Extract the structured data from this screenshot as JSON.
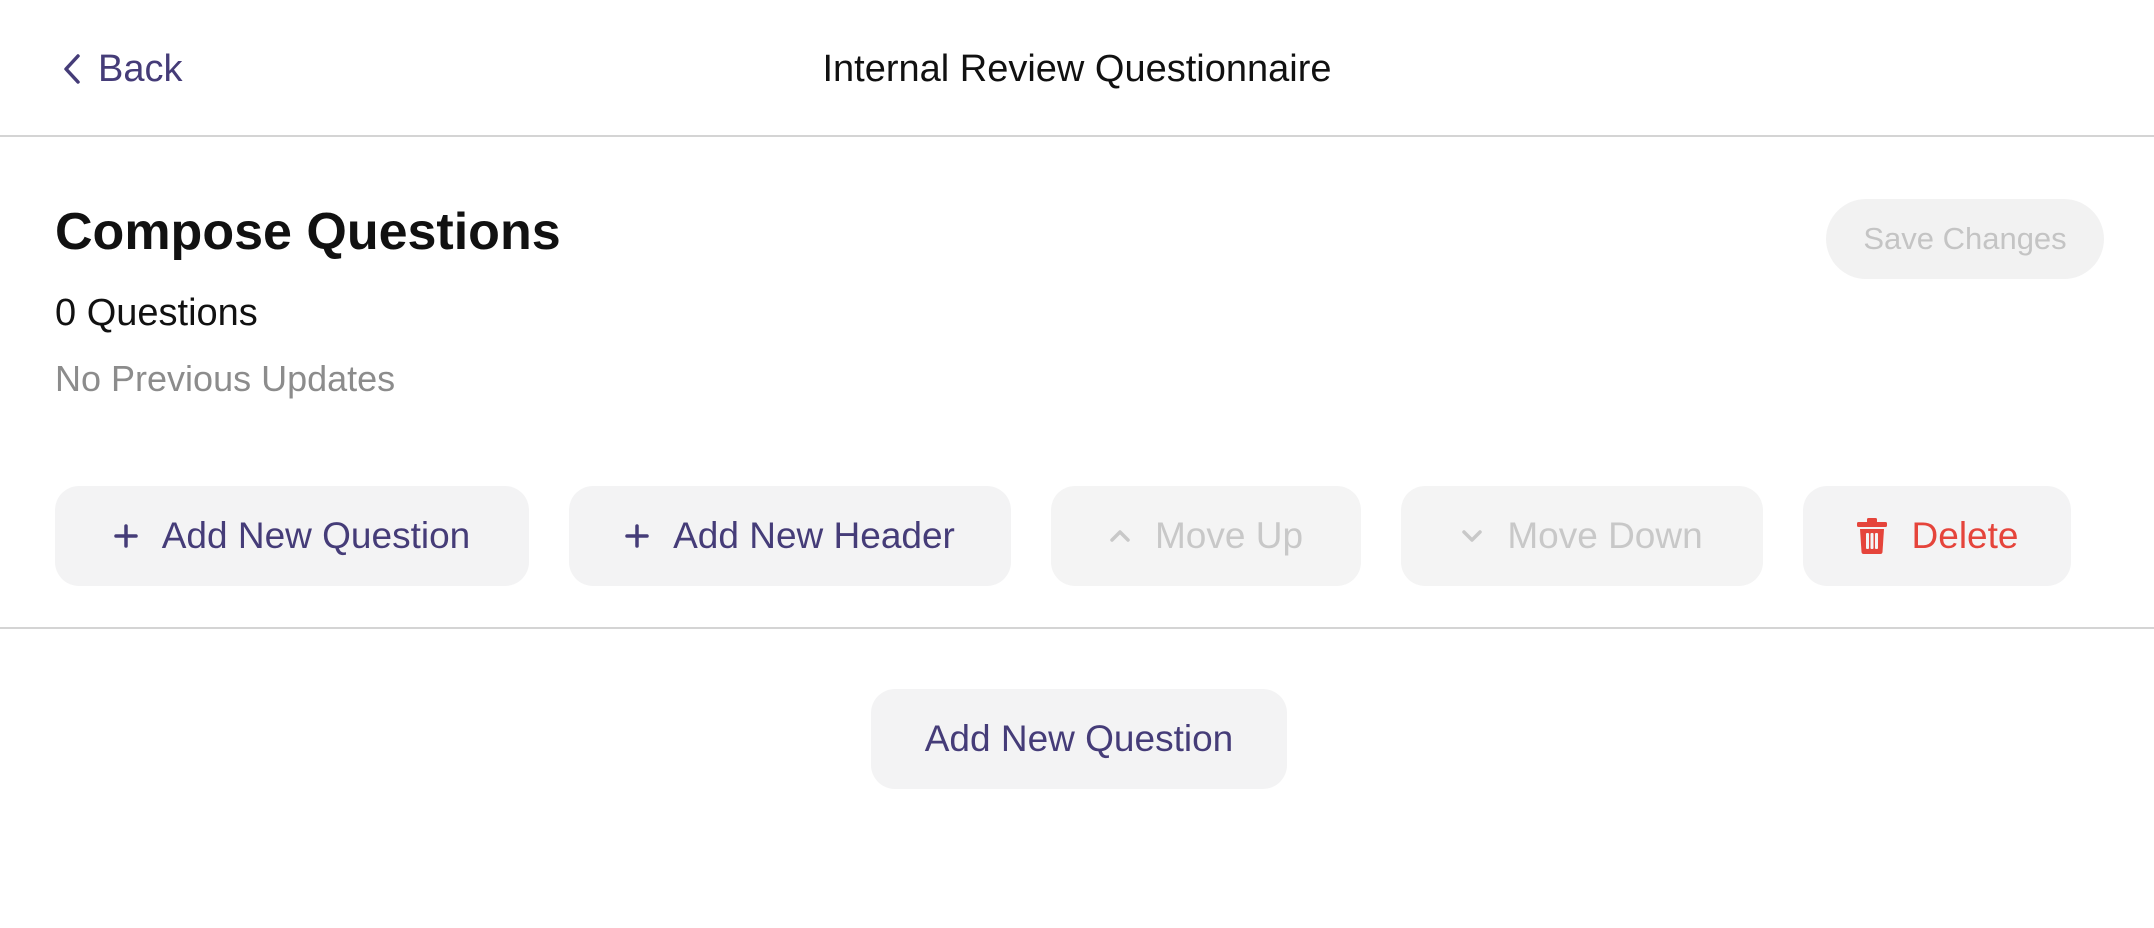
{
  "header": {
    "back_label": "Back",
    "title": "Internal Review Questionnaire",
    "back_icon": "chevron-left-icon"
  },
  "compose": {
    "title": "Compose Questions",
    "question_count": "0 Questions",
    "updates": "No Previous Updates",
    "save_label": "Save Changes",
    "save_enabled": false
  },
  "toolbar": {
    "add_question": {
      "label": "Add New Question",
      "icon": "plus-icon",
      "enabled": true
    },
    "add_header": {
      "label": "Add New Header",
      "icon": "plus-icon",
      "enabled": true
    },
    "move_up": {
      "label": "Move Up",
      "icon": "chevron-up-icon",
      "enabled": false
    },
    "move_down": {
      "label": "Move Down",
      "icon": "chevron-down-icon",
      "enabled": false
    },
    "delete": {
      "label": "Delete",
      "icon": "trash-icon",
      "enabled": true
    }
  },
  "body": {
    "add_question_label": "Add New Question"
  },
  "colors": {
    "accent": "#453c78",
    "danger": "#e5443b",
    "disabled_text": "#c8c8c8",
    "muted_text": "#8c8c8c",
    "button_bg": "#f3f3f4",
    "divider": "#d4d4d4"
  }
}
